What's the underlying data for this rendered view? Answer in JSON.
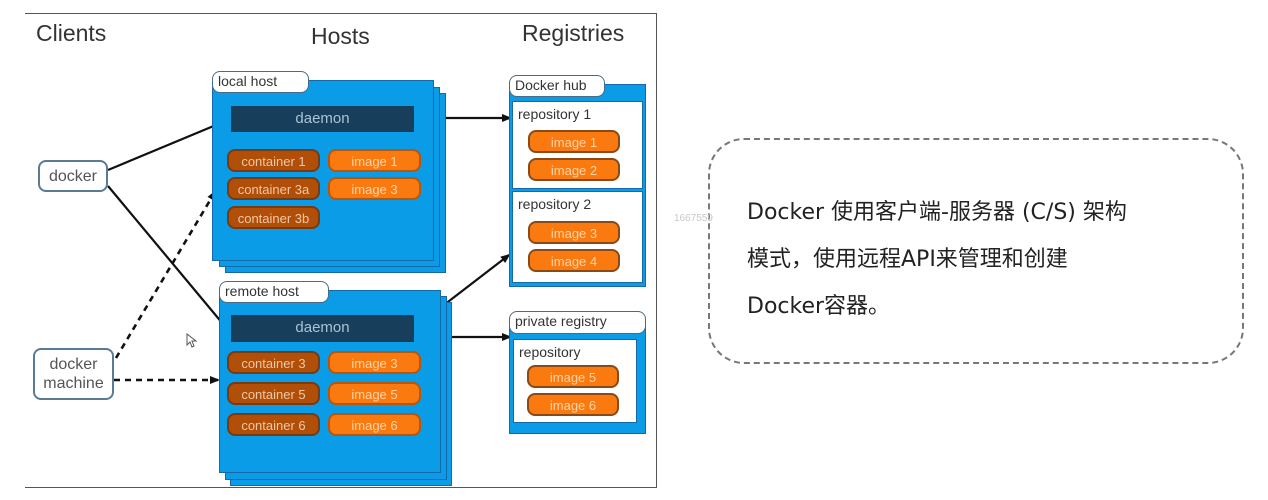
{
  "diagram": {
    "columns": {
      "clients": "Clients",
      "hosts": "Hosts",
      "registries": "Registries"
    },
    "clients": [
      {
        "label": "docker"
      },
      {
        "label": "docker\nmachine",
        "line1": "docker",
        "line2": "machine"
      }
    ],
    "hosts": [
      {
        "name": "local host",
        "daemon": "daemon",
        "containers": [
          "container 1",
          "container 3a",
          "container 3b"
        ],
        "images": [
          "image 1",
          "image 3"
        ]
      },
      {
        "name": "remote host",
        "daemon": "daemon",
        "containers": [
          "container 3",
          "container 5",
          "container 6"
        ],
        "images": [
          "image 3",
          "image 5",
          "image 6"
        ]
      }
    ],
    "registries": [
      {
        "name": "Docker hub",
        "repositories": [
          {
            "name": "repository 1",
            "images": [
              "image 1",
              "image 2"
            ]
          },
          {
            "name": "repository 2",
            "images": [
              "image 3",
              "image 4"
            ]
          }
        ]
      },
      {
        "name": "private registry",
        "repositories": [
          {
            "name": "repository",
            "images": [
              "image 5",
              "image 6"
            ]
          }
        ]
      }
    ],
    "connections": [
      {
        "from": "docker",
        "to": "local host daemon",
        "style": "solid"
      },
      {
        "from": "docker",
        "to": "remote host daemon",
        "style": "solid"
      },
      {
        "from": "docker machine",
        "to": "local host",
        "style": "dashed"
      },
      {
        "from": "docker machine",
        "to": "remote host",
        "style": "dashed"
      },
      {
        "from": "local host daemon",
        "to": "repository 1",
        "style": "solid"
      },
      {
        "from": "remote host daemon",
        "to": "repository 2",
        "style": "solid"
      },
      {
        "from": "remote host daemon",
        "to": "private registry",
        "style": "solid"
      }
    ],
    "colors": {
      "host_blue": "#0a9ce6",
      "daemon_navy": "#173f5c",
      "container_brown": "#b14e08",
      "image_orange": "#fa7a10"
    }
  },
  "note": {
    "line1": "Docker 使用客户端-服务器 (C/S) 架构",
    "line2": "模式，使用远程API来管理和创建",
    "line3": "Docker容器。"
  },
  "watermark": "1667559"
}
